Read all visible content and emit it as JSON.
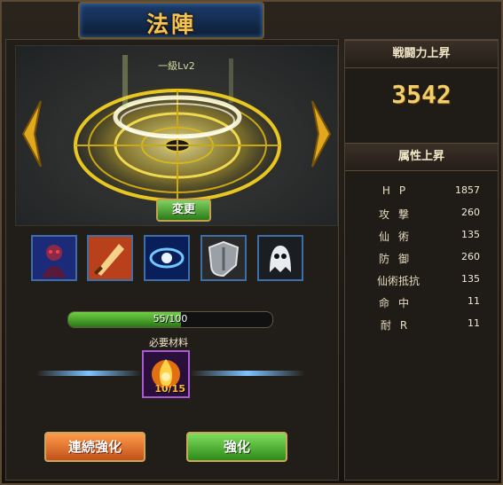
{
  "title": "法陣",
  "circle": {
    "level_label": "一級Lv2",
    "change_button": "変更"
  },
  "skills": [
    {
      "icon": "dark-spirit-icon"
    },
    {
      "icon": "sword-strike-icon"
    },
    {
      "icon": "blue-eye-icon"
    },
    {
      "icon": "shield-icon"
    },
    {
      "icon": "ghost-icon"
    }
  ],
  "progress": {
    "label": "55/100",
    "current": 55,
    "max": 100
  },
  "material": {
    "label": "必要材料",
    "count": "10/15",
    "icon": "flame-orb-icon"
  },
  "buttons": {
    "continuous": "連続強化",
    "enhance": "強化"
  },
  "power": {
    "header": "戦闘力上昇",
    "value": "3542"
  },
  "attributes": {
    "header": "属性上昇",
    "rows": [
      {
        "name": "HP",
        "value": "1857"
      },
      {
        "name": "攻撃",
        "value": "260"
      },
      {
        "name": "仙術",
        "value": "135"
      },
      {
        "name": "防御",
        "value": "260"
      },
      {
        "name": "仙術抵抗",
        "value": "135"
      },
      {
        "name": "命中",
        "value": "11"
      },
      {
        "name": "耐R",
        "value": "11"
      }
    ]
  },
  "colors": {
    "accent_gold": "#f2cf6a",
    "progress_green": "#4caf2e",
    "enhance_green": "#2d8a1a",
    "continuous_orange": "#c2511a"
  }
}
